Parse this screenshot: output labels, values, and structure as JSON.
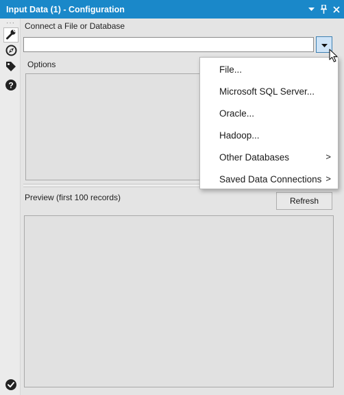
{
  "window": {
    "title": "Input Data (1) - Configuration",
    "controls": {
      "dropdown_icon": "chevron-down-icon",
      "pin_icon": "pin-icon",
      "close_icon": "close-icon"
    }
  },
  "sidebar": {
    "items": [
      {
        "name": "configuration",
        "icon": "wrench-icon",
        "active": true
      },
      {
        "name": "layout",
        "icon": "compass-icon"
      },
      {
        "name": "annotation",
        "icon": "tag-icon"
      },
      {
        "name": "help",
        "icon": "help-icon"
      }
    ],
    "status_icon": "check-circle-icon"
  },
  "connect": {
    "label": "Connect a File or Database",
    "value": "",
    "dropdown_icon": "chevron-down-icon"
  },
  "options": {
    "label": "Options"
  },
  "preview": {
    "label": "Preview (first 100 records)",
    "refresh_label": "Refresh"
  },
  "dropdown_menu": {
    "items": [
      {
        "label": "File...",
        "submenu": false
      },
      {
        "label": "Microsoft SQL Server...",
        "submenu": false
      },
      {
        "label": "Oracle...",
        "submenu": false
      },
      {
        "label": "Hadoop...",
        "submenu": false
      },
      {
        "label": "Other Databases",
        "submenu": true,
        "arrow": ">"
      },
      {
        "label": "Saved Data Connections",
        "submenu": true,
        "arrow": ">"
      }
    ]
  },
  "colors": {
    "titlebar": "#1a88c9",
    "accent_button": "#cfe4f7",
    "panel_bg": "#e4e4e4"
  }
}
